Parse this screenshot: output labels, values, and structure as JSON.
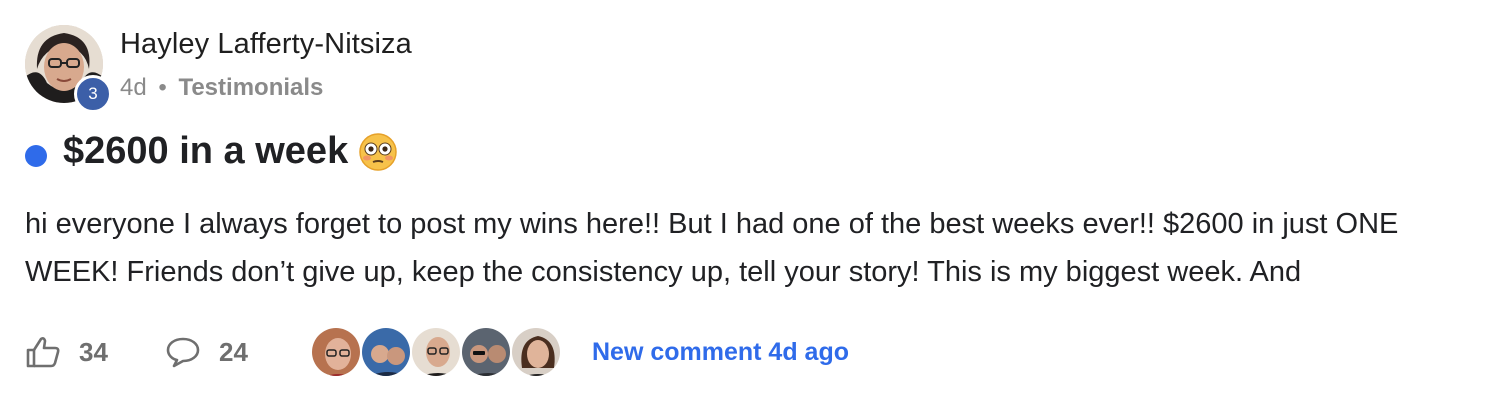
{
  "post": {
    "author": {
      "name": "Hayley Lafferty-Nitsiza",
      "level": "3"
    },
    "meta": {
      "time": "4d",
      "separator": "•",
      "category": "Testimonials"
    },
    "title": "$2600 in a week",
    "title_emoji": "flushed-face-emoji",
    "body": "hi everyone I always forget to post my wins here!! But I had one of the best weeks ever!! $2600 in just ONE WEEK! Friends don’t give up, keep the consistency up, tell your story! This is my biggest week. And",
    "footer": {
      "likes": "34",
      "comments": "24",
      "new_comment_label": "New comment 4d ago",
      "commenter_count": 5
    }
  },
  "icons": {
    "like": "thumbs-up-icon",
    "comment": "speech-bubble-icon"
  },
  "colors": {
    "accent": "#2f6bea",
    "level_badge": "#3c5fa8",
    "muted_text": "#8a8a8a"
  }
}
